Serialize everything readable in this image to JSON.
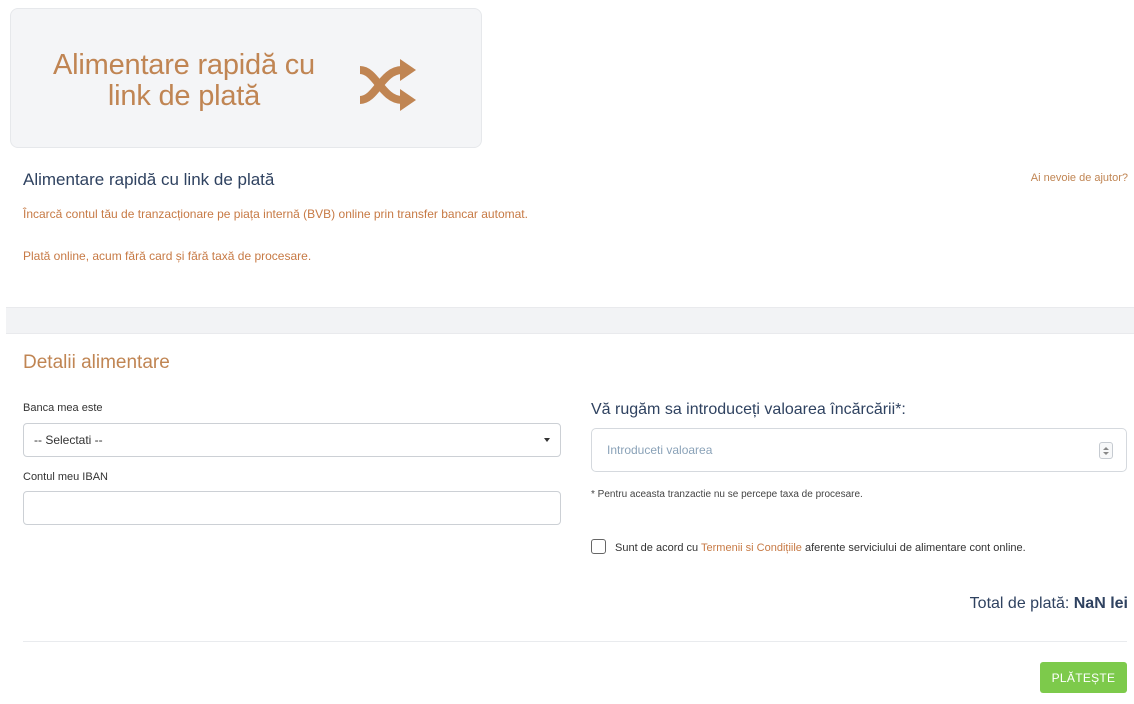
{
  "hero": {
    "title": "Alimentare rapidă cu link de plată",
    "icon": "shuffle-icon"
  },
  "section": {
    "title": "Alimentare rapidă cu link de plată",
    "help_link": "Ai nevoie de ajutor?",
    "description_line1": "Încarcă contul tău de tranzacționare pe piața internă (BVB) online prin transfer bancar automat.",
    "description_line2": "Plată online, acum fără card și fără taxă de procesare."
  },
  "details": {
    "title": "Detalii alimentare",
    "bank_label": "Banca mea este",
    "bank_select_value": "-- Selectati --",
    "iban_label": "Contul meu IBAN",
    "iban_value": ""
  },
  "amount": {
    "title": "Vă rugăm sa introduceți valoarea încărcării*:",
    "placeholder": "Introduceti valoarea",
    "note": "* Pentru aceasta tranzactie nu se percepe taxa de procesare."
  },
  "terms": {
    "prefix": "Sunt de acord cu",
    "link": "Termenii si Condițiile",
    "suffix": "aferente serviciului de alimentare cont online.",
    "checked": false
  },
  "total": {
    "label": "Total de plată:",
    "value": "NaN lei"
  },
  "pay_button": "PLĂTEȘTE",
  "colors": {
    "accent": "#c08553",
    "heading": "#2f4260",
    "button": "#7dca4b"
  }
}
